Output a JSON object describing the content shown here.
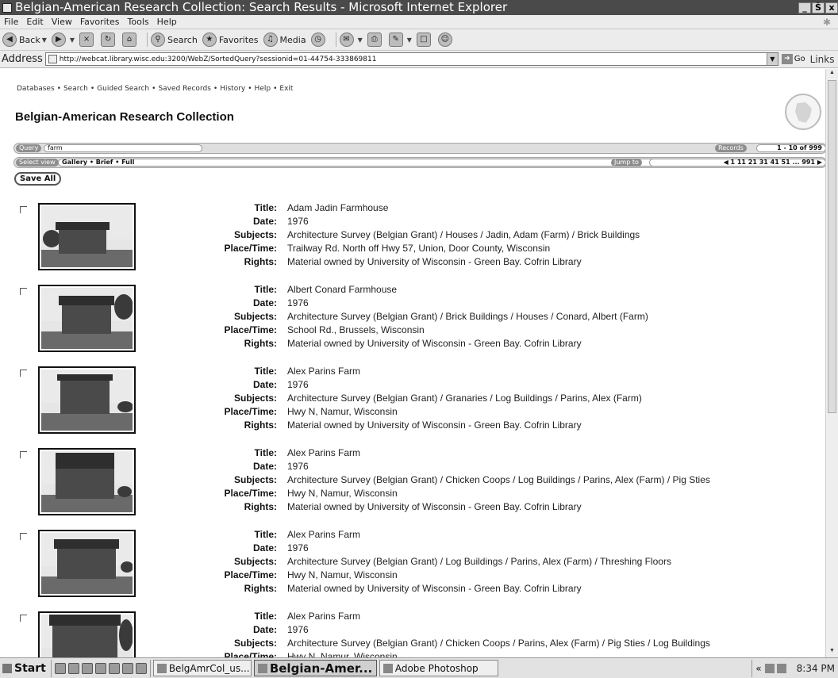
{
  "window": {
    "title": "Belgian-American Research Collection: Search Results - Microsoft Internet Explorer",
    "controls": [
      "_",
      "Š",
      "x"
    ]
  },
  "menubar": {
    "items": [
      "File",
      "Edit",
      "View",
      "Favorites",
      "Tools",
      "Help"
    ]
  },
  "toolbar": {
    "back": "Back",
    "search": "Search",
    "favorites": "Favorites",
    "media": "Media"
  },
  "addressbar": {
    "label": "Address",
    "url": "http://webcat.library.wisc.edu:3200/WebZ/SortedQuery?sessionid=01-44754-333869811",
    "go": "Go",
    "links": "Links"
  },
  "page": {
    "nav_links": [
      "Databases",
      "Search",
      "Guided Search",
      "Saved Records",
      "History",
      "Help",
      "Exit"
    ],
    "nav_separator": "•",
    "heading": "Belgian-American Research Collection",
    "query_label": "Query",
    "query_value": "farm",
    "records_label": "Records",
    "records_value": "1 - 10 of 999",
    "select_view_label": "Select view",
    "view_options": "Gallery • Brief • Full",
    "jump_label": "Jump to",
    "jump_pages": "◀ 1 11 21 31 41 51 ... 991 ▶",
    "save_all": "Save All"
  },
  "field_labels": {
    "title": "Title:",
    "date": "Date:",
    "subjects": "Subjects:",
    "place_time": "Place/Time:",
    "rights": "Rights:"
  },
  "records": [
    {
      "title": "Adam Jadin Farmhouse",
      "date": "1976",
      "subjects": "Architecture Survey (Belgian Grant) / Houses / Jadin, Adam (Farm) / Brick Buildings",
      "place_time": "Trailway Rd. North off Hwy 57, Union, Door County, Wisconsin",
      "rights": "Material owned by University of Wisconsin - Green Bay. Cofrin Library"
    },
    {
      "title": "Albert Conard Farmhouse",
      "date": "1976",
      "subjects": "Architecture Survey (Belgian Grant) / Brick Buildings / Houses / Conard, Albert (Farm)",
      "place_time": "School Rd., Brussels, Wisconsin",
      "rights": "Material owned by University of Wisconsin - Green Bay. Cofrin Library"
    },
    {
      "title": "Alex Parins Farm",
      "date": "1976",
      "subjects": "Architecture Survey (Belgian Grant) / Granaries / Log Buildings / Parins, Alex (Farm)",
      "place_time": "Hwy N, Namur, Wisconsin",
      "rights": "Material owned by University of Wisconsin - Green Bay. Cofrin Library"
    },
    {
      "title": "Alex Parins Farm",
      "date": "1976",
      "subjects": "Architecture Survey (Belgian Grant) / Chicken Coops / Log Buildings / Parins, Alex (Farm) / Pig Sties",
      "place_time": "Hwy N, Namur, Wisconsin",
      "rights": "Material owned by University of Wisconsin - Green Bay. Cofrin Library"
    },
    {
      "title": "Alex Parins Farm",
      "date": "1976",
      "subjects": "Architecture Survey (Belgian Grant) / Log Buildings / Parins, Alex (Farm) / Threshing Floors",
      "place_time": "Hwy N, Namur, Wisconsin",
      "rights": "Material owned by University of Wisconsin - Green Bay. Cofrin Library"
    },
    {
      "title": "Alex Parins Farm",
      "date": "1976",
      "subjects": "Architecture Survey (Belgian Grant) / Chicken Coops / Parins, Alex (Farm) / Pig Sties / Log Buildings",
      "place_time": "Hwy N, Namur, Wisconsin",
      "rights": ""
    }
  ],
  "taskbar": {
    "start": "Start",
    "tasks": [
      "BelgAmrCol_us...",
      "Belgian-Amer...",
      "Adobe Photoshop"
    ],
    "tray_chevron": "«",
    "clock": "8:34 PM"
  }
}
